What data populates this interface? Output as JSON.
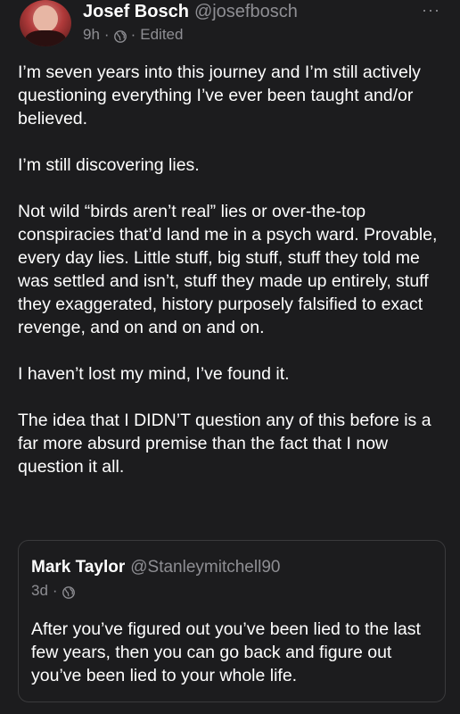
{
  "post": {
    "author": {
      "display_name": "Josef Bosch",
      "handle": "@josefbosch"
    },
    "meta": {
      "time": "9h",
      "separator": "·",
      "visibility_icon": "globe-icon",
      "edited": "Edited"
    },
    "more_label": "···",
    "paragraphs": [
      "I’m seven years into this journey and I’m still actively questioning everything I’ve ever been taught and/or believed.",
      "I’m still discovering lies.",
      "Not wild “birds aren’t real” lies or over-the-top conspiracies that’d land me in a psych ward. Provable, every day lies. Little stuff, big stuff, stuff they told me was settled and isn’t, stuff they made up entirely, stuff they exaggerated, history purposely falsified to exact revenge, and on and on and on.",
      "I haven’t lost my mind, I’ve found it.",
      "The idea that I DIDN’T question any of this before is a far more absurd premise than the fact that I now question it all."
    ]
  },
  "quoted_post": {
    "author": {
      "display_name": "Mark Taylor",
      "handle": "@Stanleymitchell90"
    },
    "meta": {
      "time": "3d",
      "separator": "·",
      "visibility_icon": "globe-icon"
    },
    "text": "After you’ve figured out you’ve been lied to the last few years, then you can go back and figure out you’ve been lied to your whole life."
  },
  "colors": {
    "background": "#1c1c1e",
    "text": "#ffffff",
    "secondary": "#8e8e93",
    "border": "#3a3a3c"
  }
}
